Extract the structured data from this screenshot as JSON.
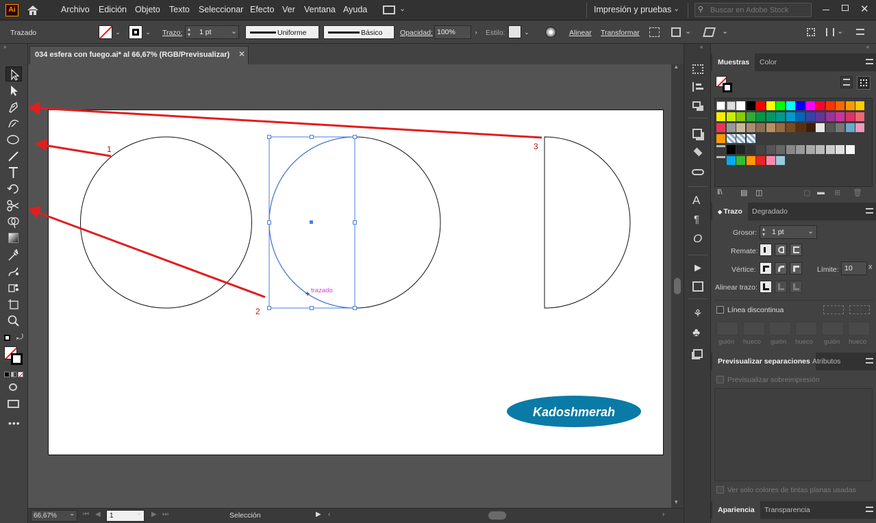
{
  "app": {
    "logo": "Ai",
    "title": "034 esfera con fuego.ai* al 66,67% (RGB/Previsualizar)"
  },
  "menu": {
    "items": [
      "Archivo",
      "Edición",
      "Objeto",
      "Texto",
      "Seleccionar",
      "Efecto",
      "Ver",
      "Ventana",
      "Ayuda"
    ],
    "workspace": "Impresión y pruebas",
    "search_placeholder": "Buscar en Adobe Stock"
  },
  "control": {
    "object_type": "Trazado",
    "stroke_label": "Trazo:",
    "stroke_weight": "1 pt",
    "profile_label": "Uniforme",
    "brush_label": "Básico",
    "opacity_label": "Opacidad:",
    "opacity_value": "100%",
    "style_label": "Estilo:",
    "align_label": "Alinear",
    "transform_label": "Transformar"
  },
  "canvas": {
    "annotations": [
      "1",
      "2",
      "3"
    ],
    "hover_label": "trazado",
    "watermark": "Kadoshmerah",
    "accent_color": "#e31d1d",
    "selection_color": "#4a7ee0"
  },
  "status": {
    "zoom": "66,67%",
    "artboard": "1",
    "tool": "Selección"
  },
  "swatches_panel": {
    "tabs": [
      "Muestras",
      "Color"
    ]
  },
  "stroke_panel": {
    "tabs": [
      "Trazo",
      "Degradado"
    ],
    "weight_label": "Grosor:",
    "weight_value": "1 pt",
    "cap_label": "Remate:",
    "corner_label": "Vértice:",
    "limit_label": "Límite:",
    "limit_value": "10",
    "align_label": "Alinear trazo:",
    "dashed_label": "Línea discontinua",
    "dash_fields": [
      "guión",
      "hueco",
      "guión",
      "hueco",
      "guión",
      "hueco"
    ]
  },
  "separations_panel": {
    "tabs": [
      "Previsualizar separaciones",
      "Atributos"
    ],
    "overprint_label": "Previsualizar sobreimpresión",
    "spot_label": "Ver solo colores de tintas planas usadas"
  },
  "appearance_panel": {
    "tabs": [
      "Apariencia",
      "Transparencia"
    ]
  }
}
